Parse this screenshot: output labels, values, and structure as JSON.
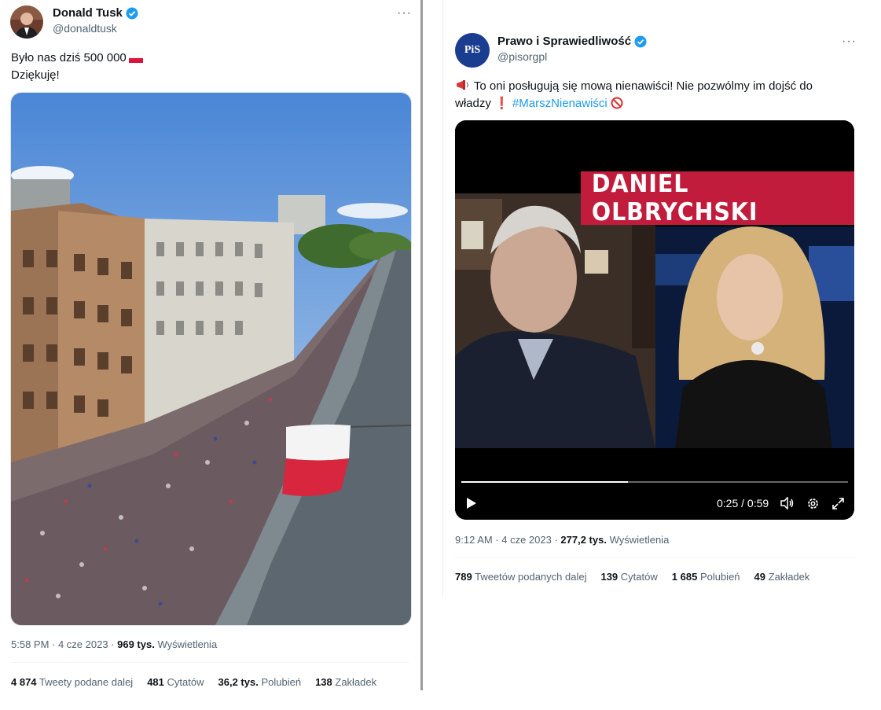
{
  "tweet_left": {
    "author_name": "Donald Tusk",
    "handle": "@donaldtusk",
    "more_label": "···",
    "text_line1": "Było nas dziś 500 000",
    "text_line2": "Dziękuję!",
    "time": "5:58 PM · 4 cze 2023 · ",
    "views_count": "969 tys.",
    "views_label": " Wyświetlenia",
    "stats": [
      {
        "count": "4 874",
        "label": "Tweety podane dalej"
      },
      {
        "count": "481",
        "label": "Cytatów"
      },
      {
        "count": "36,2 tys.",
        "label": "Polubień"
      },
      {
        "count": "138",
        "label": "Zakładek"
      }
    ]
  },
  "tweet_right": {
    "author_name": "Prawo i Sprawiedliwość",
    "handle": "@pisorgpl",
    "more_label": "···",
    "avatar_text": "PiS",
    "text_part1": "To oni posługują się mową nienawiści! Nie pozwólmy im dojść do",
    "text_part2": "władzy",
    "hashtag": "#MarszNienawiści",
    "video_banner": "DANIEL OLBRYCHSKI",
    "video_time": "0:25 / 0:59",
    "video_progress": 0.43,
    "time": "9:12 AM · 4 cze 2023 · ",
    "views_count": "277,2 tys.",
    "views_label": " Wyświetlenia",
    "stats": [
      {
        "count": "789",
        "label": "Tweetów podanych dalej"
      },
      {
        "count": "139",
        "label": "Cytatów"
      },
      {
        "count": "1 685",
        "label": "Polubień"
      },
      {
        "count": "49",
        "label": "Zakładek"
      }
    ]
  },
  "colors": {
    "accent": "#1d9bf0",
    "verified": "#1d9bf0",
    "flag_red": "#dc143c"
  }
}
